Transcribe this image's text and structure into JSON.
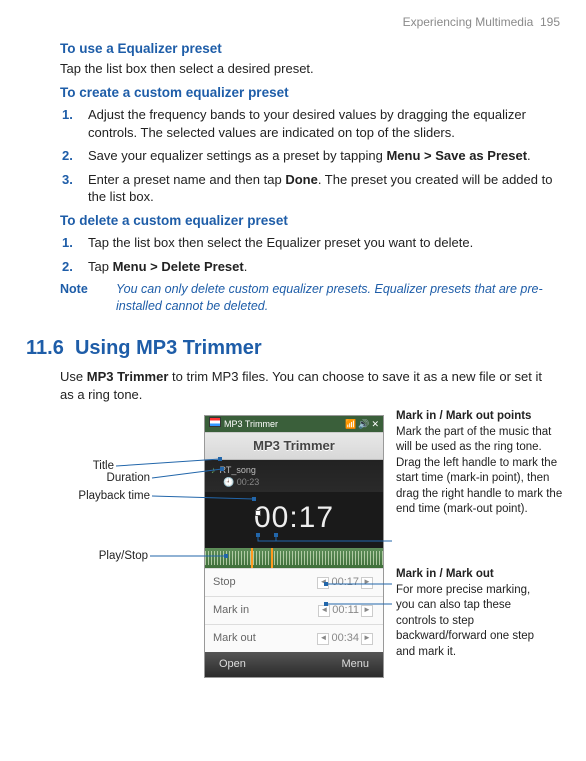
{
  "runhead": {
    "chapter": "Experiencing Multimedia",
    "page": "195"
  },
  "use_preset": {
    "heading": "To use a Equalizer preset",
    "text": "Tap the list box then select a desired preset."
  },
  "create_preset": {
    "heading": "To create a custom equalizer preset",
    "steps": [
      {
        "num": "1.",
        "text": "Adjust the frequency bands to your desired values by dragging the equalizer controls. The selected values are indicated on top of the sliders."
      },
      {
        "num": "2.",
        "before": "Save your equalizer settings as a preset by tapping ",
        "bold": "Menu > Save as Preset",
        "after": "."
      },
      {
        "num": "3.",
        "before": "Enter a preset name and then tap ",
        "bold": "Done",
        "after": ". The preset you created will be added to the list box."
      }
    ]
  },
  "delete_preset": {
    "heading": "To delete a custom equalizer preset",
    "steps": [
      {
        "num": "1.",
        "text": "Tap the list box then select the Equalizer preset you want to delete."
      },
      {
        "num": "2.",
        "before": "Tap ",
        "bold": "Menu > Delete Preset",
        "after": "."
      }
    ]
  },
  "note": {
    "label": "Note",
    "text": "You can only delete custom equalizer presets. Equalizer presets that are pre-installed cannot be deleted."
  },
  "section": {
    "number": "11.6",
    "title": "Using MP3 Trimmer"
  },
  "intro": {
    "before": "Use ",
    "bold": "MP3 Trimmer",
    "after": " to trim MP3 files. You can choose to save it as a new file or set it as a ring tone."
  },
  "phone": {
    "app_name": "MP3 Trimmer",
    "title": "MP3 Trimmer",
    "song": "RT_song",
    "duration": "00:23",
    "playback": "00:17",
    "rows": [
      {
        "label": "Stop",
        "time": "00:17"
      },
      {
        "label": "Mark in",
        "time": "00:11"
      },
      {
        "label": "Mark out",
        "time": "00:34"
      }
    ],
    "softkeys": {
      "left": "Open",
      "right": "Menu"
    }
  },
  "callouts": {
    "title": "Title",
    "duration": "Duration",
    "playback_time": "Playback time",
    "play_stop": "Play/Stop",
    "mark_points": {
      "heading": "Mark in / Mark out points",
      "text": "Mark the part of the music that will be used as the ring tone. Drag the left handle to mark the start time (mark-in point), then drag the right handle to mark the end time (mark-out point)."
    },
    "mark_controls": {
      "heading": "Mark in / Mark out",
      "text": "For more precise marking, you can also tap these controls to step backward/forward one step and mark it."
    }
  }
}
